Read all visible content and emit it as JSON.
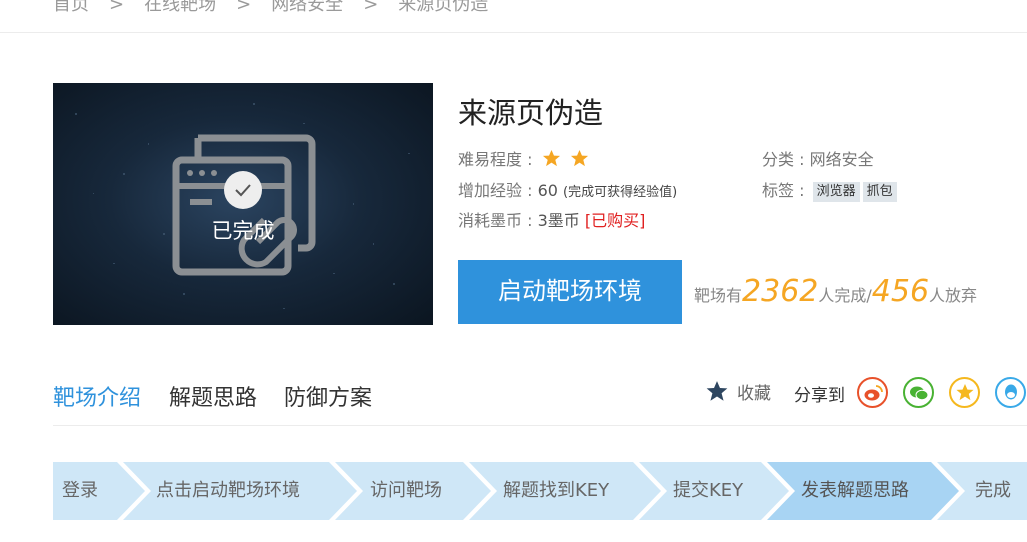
{
  "breadcrumb": [
    "首页",
    "在线靶场",
    "网络安全",
    "来源页伪造"
  ],
  "breadcrumb_separator": ">",
  "cover": {
    "status_label": "已完成",
    "status_icon": "check-icon"
  },
  "lab": {
    "title": "来源页伪造",
    "difficulty_label": "难易程度 :",
    "difficulty_stars": 2,
    "experience_label": "增加经验 : ",
    "experience_value": "60",
    "experience_note": "(完成可获得经验值)",
    "cost_label": "消耗墨币 : ",
    "cost_value": "3墨币",
    "purchase_status": "[已购买]",
    "category_label": "分类 : ",
    "category_value": "网络安全",
    "tags_label": "标签 : ",
    "tags": [
      "浏览器",
      "抓包"
    ]
  },
  "launch_button": "启动靶场环境",
  "stats": {
    "prefix": "靶场有",
    "completed": "2362",
    "completed_suffix": "人完成/",
    "abandoned": "456",
    "abandoned_suffix": "人放弃"
  },
  "tabs": [
    "靶场介绍",
    "解题思路",
    "防御方案"
  ],
  "active_tab": 0,
  "favorite_label": "收藏",
  "share_label": "分享到",
  "share_targets": [
    "weibo-icon",
    "wechat-icon",
    "qzone-icon",
    "qq-icon"
  ],
  "steps": [
    "登录",
    "点击启动靶场环境",
    "访问靶场",
    "解题找到KEY",
    "提交KEY",
    "发表解题思路",
    "完成"
  ],
  "active_step": 5,
  "colors": {
    "accent": "#2f92dc",
    "star": "#f5a623",
    "step_bg": "#cfe7f7",
    "step_active": "#a8d4f3",
    "bought": "#e02020"
  }
}
